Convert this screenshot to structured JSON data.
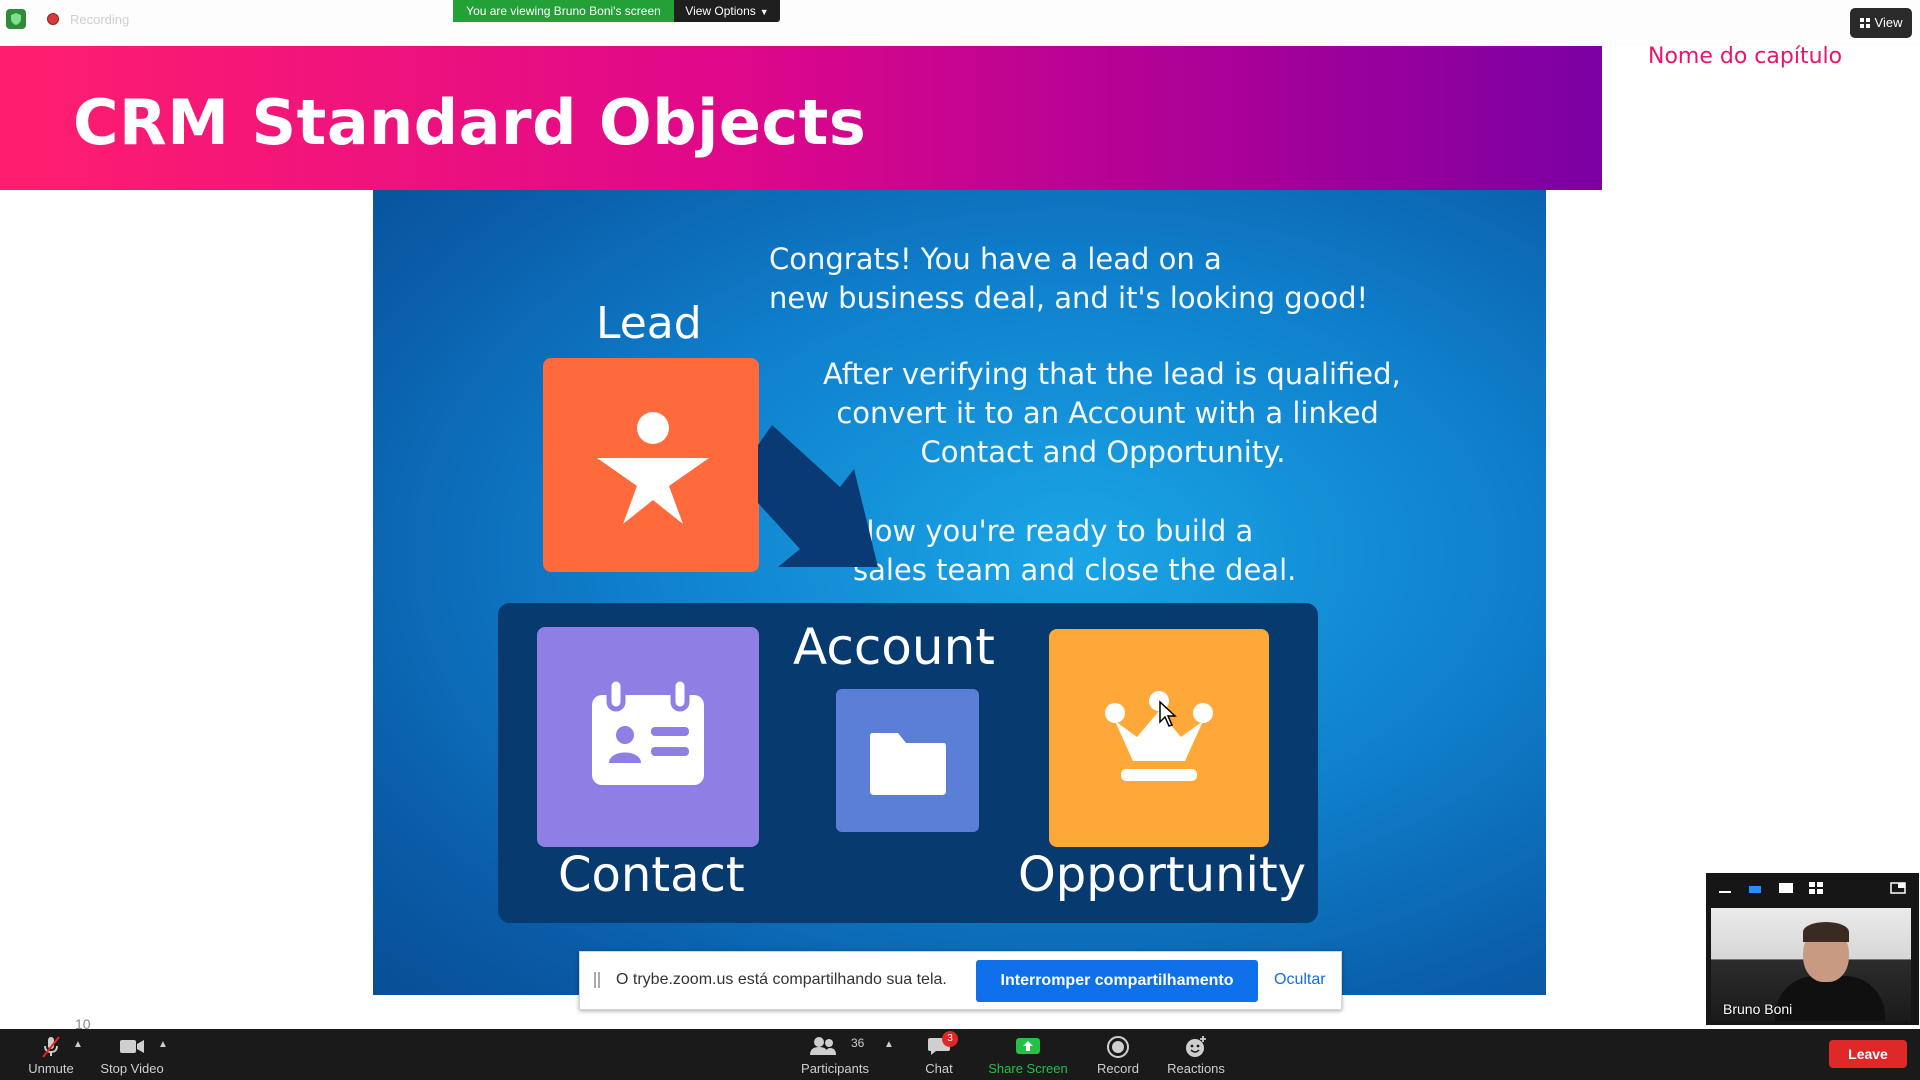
{
  "topbar": {
    "recording_label": "Recording",
    "viewing_banner": "You are viewing Bruno Boni's screen",
    "view_options_label": "View Options",
    "view_button_label": "View"
  },
  "slide": {
    "title": "CRM Standard Objects",
    "chapter_label": "Nome do capítulo",
    "congrats_text": "Congrats! You have a lead on a\nnew business deal, and it's looking good!",
    "after_text": "After verifying that the lead is qualified,\n convert it to an Account with a linked\nContact and Opportunity.",
    "ready_text": "Now you're ready to build a\nsales team and close the deal.",
    "lead_label": "Lead",
    "account_label": "Account",
    "contact_label": "Contact",
    "opportunity_label": "Opportunity",
    "page_number": "10"
  },
  "share_notice": {
    "message": "O trybe.zoom.us está compartilhando sua tela.",
    "stop_button": "Interromper compartilhamento",
    "hide_link": "Ocultar"
  },
  "self_view": {
    "name": "Bruno Boni"
  },
  "toolbar": {
    "unmute_label": "Unmute",
    "stop_video_label": "Stop Video",
    "participants_label": "Participants",
    "participants_count": "36",
    "chat_label": "Chat",
    "chat_badge": "3",
    "share_screen_label": "Share Screen",
    "record_label": "Record",
    "reactions_label": "Reactions",
    "leave_label": "Leave"
  },
  "colors": {
    "header_gradient_start": "#ff1e6e",
    "header_gradient_end": "#7a00a3",
    "chapter_color": "#e8156e",
    "share_green": "#23a036",
    "zoom_blue": "#0e71eb",
    "leave_red": "#e02828"
  }
}
